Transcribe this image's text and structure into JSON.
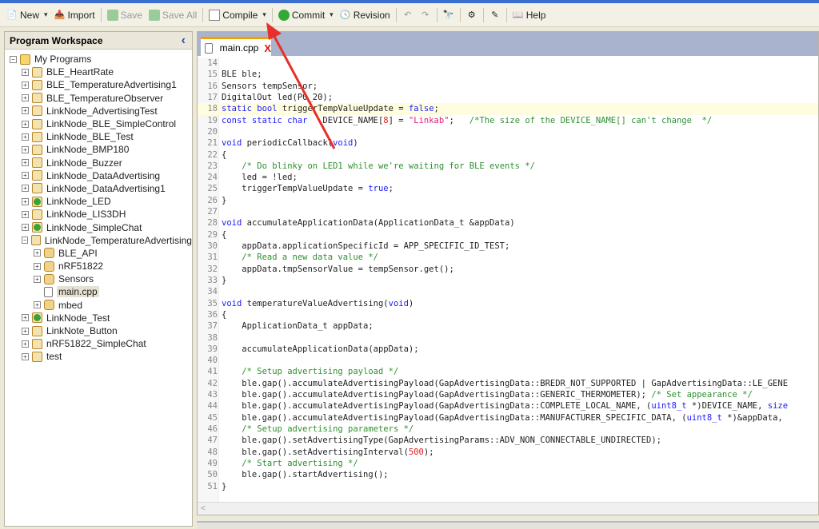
{
  "toolbar": {
    "new": "New",
    "import": "Import",
    "save": "Save",
    "save_all": "Save All",
    "compile": "Compile",
    "commit": "Commit",
    "revision": "Revision",
    "help": "Help"
  },
  "sidebar": {
    "title": "Program Workspace",
    "collapse": "‹",
    "tree": [
      {
        "label": "My Programs",
        "depth": 0,
        "exp": "−",
        "icon": "programs"
      },
      {
        "label": "BLE_HeartRate",
        "depth": 1,
        "exp": "+",
        "icon": "prog"
      },
      {
        "label": "BLE_TemperatureAdvertising1",
        "depth": 1,
        "exp": "+",
        "icon": "prog"
      },
      {
        "label": "BLE_TemperatureObserver",
        "depth": 1,
        "exp": "+",
        "icon": "prog"
      },
      {
        "label": "LinkNode_AdvertisingTest",
        "depth": 1,
        "exp": "+",
        "icon": "prog"
      },
      {
        "label": "LinkNode_BLE_SimpleControl",
        "depth": 1,
        "exp": "+",
        "icon": "prog"
      },
      {
        "label": "LinkNode_BLE_Test",
        "depth": 1,
        "exp": "+",
        "icon": "prog"
      },
      {
        "label": "LinkNode_BMP180",
        "depth": 1,
        "exp": "+",
        "icon": "prog"
      },
      {
        "label": "LinkNode_Buzzer",
        "depth": 1,
        "exp": "+",
        "icon": "prog"
      },
      {
        "label": "LinkNode_DataAdvertising",
        "depth": 1,
        "exp": "+",
        "icon": "prog"
      },
      {
        "label": "LinkNode_DataAdvertising1",
        "depth": 1,
        "exp": "+",
        "icon": "prog"
      },
      {
        "label": "LinkNode_LED",
        "depth": 1,
        "exp": "+",
        "icon": "green"
      },
      {
        "label": "LinkNode_LIS3DH",
        "depth": 1,
        "exp": "+",
        "icon": "prog"
      },
      {
        "label": "LinkNode_SimpleChat",
        "depth": 1,
        "exp": "+",
        "icon": "green"
      },
      {
        "label": "LinkNode_TemperatureAdvertising",
        "depth": 1,
        "exp": "−",
        "icon": "prog"
      },
      {
        "label": "BLE_API",
        "depth": 2,
        "exp": "+",
        "icon": "dir"
      },
      {
        "label": "nRF51822",
        "depth": 2,
        "exp": "+",
        "icon": "dir"
      },
      {
        "label": "Sensors",
        "depth": 2,
        "exp": "+",
        "icon": "dir"
      },
      {
        "label": "main.cpp",
        "depth": 2,
        "exp": "",
        "icon": "file",
        "selected": true
      },
      {
        "label": "mbed",
        "depth": 2,
        "exp": "+",
        "icon": "dir"
      },
      {
        "label": "LinkNode_Test",
        "depth": 1,
        "exp": "+",
        "icon": "green"
      },
      {
        "label": "LinkNote_Button",
        "depth": 1,
        "exp": "+",
        "icon": "prog"
      },
      {
        "label": "nRF51822_SimpleChat",
        "depth": 1,
        "exp": "+",
        "icon": "prog"
      },
      {
        "label": "test",
        "depth": 1,
        "exp": "+",
        "icon": "prog"
      }
    ]
  },
  "editor": {
    "tab": "main.cpp",
    "tab_close": "X",
    "highlight_line": 18,
    "lines": [
      {
        "n": "14",
        "t": []
      },
      {
        "n": "15",
        "t": [
          [
            "t",
            "BLE ble;"
          ]
        ]
      },
      {
        "n": "16",
        "t": [
          [
            "t",
            "Sensors tempSensor;"
          ]
        ]
      },
      {
        "n": "17",
        "t": [
          [
            "t",
            "DigitalOut led(P0_20);"
          ]
        ]
      },
      {
        "n": "18",
        "t": [
          [
            "k",
            "static bool"
          ],
          [
            "t",
            " triggerTempValueUpdate = "
          ],
          [
            "k",
            "false"
          ],
          [
            "t",
            ";"
          ]
        ]
      },
      {
        "n": "19",
        "t": [
          [
            "k",
            "const static char"
          ],
          [
            "t",
            "   DEVICE_NAME["
          ],
          [
            "n",
            "8"
          ],
          [
            "t",
            "] = "
          ],
          [
            "s",
            "\"Linkab\""
          ],
          [
            "t",
            ";   "
          ],
          [
            "c",
            "/*The size of the DEVICE_NAME[] can't change  */"
          ]
        ]
      },
      {
        "n": "20",
        "t": []
      },
      {
        "n": "21",
        "t": [
          [
            "k",
            "void"
          ],
          [
            "t",
            " periodicCallback("
          ],
          [
            "k",
            "void"
          ],
          [
            "t",
            ")"
          ]
        ]
      },
      {
        "n": "22",
        "t": [
          [
            "t",
            "{"
          ]
        ]
      },
      {
        "n": "23",
        "t": [
          [
            "t",
            "    "
          ],
          [
            "c",
            "/* Do blinky on LED1 while we're waiting for BLE events */"
          ]
        ]
      },
      {
        "n": "24",
        "t": [
          [
            "t",
            "    led = !led;"
          ]
        ]
      },
      {
        "n": "25",
        "t": [
          [
            "t",
            "    triggerTempValueUpdate = "
          ],
          [
            "k",
            "true"
          ],
          [
            "t",
            ";"
          ]
        ]
      },
      {
        "n": "26",
        "t": [
          [
            "t",
            "}"
          ]
        ]
      },
      {
        "n": "27",
        "t": []
      },
      {
        "n": "28",
        "t": [
          [
            "k",
            "void"
          ],
          [
            "t",
            " accumulateApplicationData(ApplicationData_t &appData)"
          ]
        ]
      },
      {
        "n": "29",
        "t": [
          [
            "t",
            "{"
          ]
        ]
      },
      {
        "n": "30",
        "t": [
          [
            "t",
            "    appData.applicationSpecificId = APP_SPECIFIC_ID_TEST;"
          ]
        ]
      },
      {
        "n": "31",
        "t": [
          [
            "t",
            "    "
          ],
          [
            "c",
            "/* Read a new data value */"
          ]
        ]
      },
      {
        "n": "32",
        "t": [
          [
            "t",
            "    appData.tmpSensorValue = tempSensor.get();"
          ]
        ]
      },
      {
        "n": "33",
        "t": [
          [
            "t",
            "}"
          ]
        ]
      },
      {
        "n": "34",
        "t": []
      },
      {
        "n": "35",
        "t": [
          [
            "k",
            "void"
          ],
          [
            "t",
            " temperatureValueAdvertising("
          ],
          [
            "k",
            "void"
          ],
          [
            "t",
            ")"
          ]
        ]
      },
      {
        "n": "36",
        "t": [
          [
            "t",
            "{"
          ]
        ]
      },
      {
        "n": "37",
        "t": [
          [
            "t",
            "    ApplicationData_t appData;"
          ]
        ]
      },
      {
        "n": "38",
        "t": []
      },
      {
        "n": "39",
        "t": [
          [
            "t",
            "    accumulateApplicationData(appData);"
          ]
        ]
      },
      {
        "n": "40",
        "t": []
      },
      {
        "n": "41",
        "t": [
          [
            "t",
            "    "
          ],
          [
            "c",
            "/* Setup advertising payload */"
          ]
        ]
      },
      {
        "n": "42",
        "t": [
          [
            "t",
            "    ble.gap().accumulateAdvertisingPayload(GapAdvertisingData::BREDR_NOT_SUPPORTED | GapAdvertisingData::LE_GENE"
          ]
        ]
      },
      {
        "n": "43",
        "t": [
          [
            "t",
            "    ble.gap().accumulateAdvertisingPayload(GapAdvertisingData::GENERIC_THERMOMETER); "
          ],
          [
            "c",
            "/* Set appearance */"
          ]
        ]
      },
      {
        "n": "44",
        "t": [
          [
            "t",
            "    ble.gap().accumulateAdvertisingPayload(GapAdvertisingData::COMPLETE_LOCAL_NAME, ("
          ],
          [
            "k",
            "uint8_t"
          ],
          [
            "t",
            " *)DEVICE_NAME, "
          ],
          [
            "k",
            "size"
          ]
        ]
      },
      {
        "n": "45",
        "t": [
          [
            "t",
            "    ble.gap().accumulateAdvertisingPayload(GapAdvertisingData::MANUFACTURER_SPECIFIC_DATA, ("
          ],
          [
            "k",
            "uint8_t"
          ],
          [
            "t",
            " *)&appData,"
          ]
        ]
      },
      {
        "n": "46",
        "t": [
          [
            "t",
            "    "
          ],
          [
            "c",
            "/* Setup advertising parameters */"
          ]
        ]
      },
      {
        "n": "47",
        "t": [
          [
            "t",
            "    ble.gap().setAdvertisingType(GapAdvertisingParams::ADV_NON_CONNECTABLE_UNDIRECTED);"
          ]
        ]
      },
      {
        "n": "48",
        "t": [
          [
            "t",
            "    ble.gap().setAdvertisingInterval("
          ],
          [
            "n",
            "500"
          ],
          [
            "t",
            ");"
          ]
        ]
      },
      {
        "n": "49",
        "t": [
          [
            "t",
            "    "
          ],
          [
            "c",
            "/* Start advertising */"
          ]
        ]
      },
      {
        "n": "50",
        "t": [
          [
            "t",
            "    ble.gap().startAdvertising();"
          ]
        ]
      },
      {
        "n": "51",
        "t": [
          [
            "t",
            "}"
          ]
        ]
      }
    ]
  },
  "colors": {
    "annotation_arrow": "#e8302a",
    "tab_accent": "#f0a000",
    "keyword": "#1a1aff",
    "comment": "#2f8f2f"
  }
}
